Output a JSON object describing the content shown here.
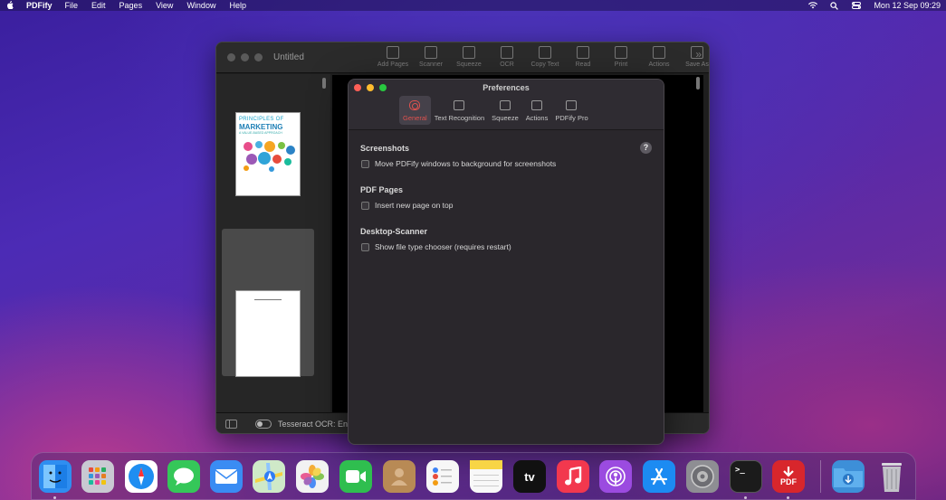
{
  "menubar": {
    "app_name": "PDFify",
    "items": [
      "File",
      "Edit",
      "Pages",
      "View",
      "Window",
      "Help"
    ],
    "clock": "Mon 12 Sep  09:29",
    "status_icons": [
      "wifi-icon",
      "search-icon",
      "control-center-icon"
    ]
  },
  "window": {
    "title": "Untitled",
    "toolbar": [
      {
        "label": "Add Pages",
        "icon": "add-pages-icon"
      },
      {
        "label": "Scanner",
        "icon": "scanner-icon"
      },
      {
        "label": "Squeeze",
        "icon": "squeeze-icon"
      },
      {
        "label": "OCR",
        "icon": "ocr-icon"
      },
      {
        "label": "Copy Text",
        "icon": "copy-text-icon"
      },
      {
        "label": "Read",
        "icon": "read-icon"
      },
      {
        "label": "Print",
        "icon": "print-icon"
      },
      {
        "label": "Actions",
        "icon": "actions-icon"
      },
      {
        "label": "Save As",
        "icon": "save-as-icon"
      }
    ],
    "thumb1": {
      "line1": "PRINCIPLES OF",
      "line2": "MARKETING",
      "line3": "A VALUE-BASED APPROACH"
    },
    "statusbar": {
      "ocr_label": "Tesseract OCR: Eng"
    }
  },
  "preferences": {
    "title": "Preferences",
    "tabs": [
      {
        "label": "General",
        "active": true
      },
      {
        "label": "Text Recognition",
        "active": false
      },
      {
        "label": "Squeeze",
        "active": false
      },
      {
        "label": "Actions",
        "active": false
      },
      {
        "label": "PDFify Pro",
        "active": false
      }
    ],
    "sections": [
      {
        "title": "Screenshots",
        "option": "Move PDFify windows to background for screenshots",
        "checked": false
      },
      {
        "title": "PDF Pages",
        "option": "Insert new page on top",
        "checked": false
      },
      {
        "title": "Desktop-Scanner",
        "option": "Show file type chooser (requires restart)",
        "checked": false
      }
    ],
    "help": "?"
  },
  "dock": {
    "apps": [
      {
        "name": "finder",
        "color": "#2f8ef0"
      },
      {
        "name": "launchpad",
        "color": "#c9c9d2"
      },
      {
        "name": "safari",
        "color": "#1f8ef1"
      },
      {
        "name": "messages",
        "color": "#35c759"
      },
      {
        "name": "mail",
        "color": "#3a8cf3"
      },
      {
        "name": "maps",
        "color": "#5cbf6a"
      },
      {
        "name": "photos",
        "color": "#f2f2f2"
      },
      {
        "name": "facetime",
        "color": "#2fbe4f"
      },
      {
        "name": "contacts",
        "color": "#b88a55"
      },
      {
        "name": "reminders",
        "color": "#f7f7f7"
      },
      {
        "name": "notes",
        "color": "#f8d545"
      },
      {
        "name": "apple-tv",
        "color": "#111111"
      },
      {
        "name": "music",
        "color": "#f2384e"
      },
      {
        "name": "podcasts",
        "color": "#9b4be0"
      },
      {
        "name": "app-store",
        "color": "#1c8bf2"
      },
      {
        "name": "system-preferences",
        "color": "#8e8e93"
      },
      {
        "name": "terminal",
        "color": "#1b1b1b"
      },
      {
        "name": "pdfify",
        "color": "#d8262c"
      }
    ],
    "appletv_label": "tv",
    "pdf_label": "PDF",
    "terminal_label": ">_",
    "extras": [
      {
        "name": "downloads-folder",
        "color": "#3d8fd8"
      },
      {
        "name": "trash",
        "color": "#b8b8bf"
      }
    ]
  }
}
